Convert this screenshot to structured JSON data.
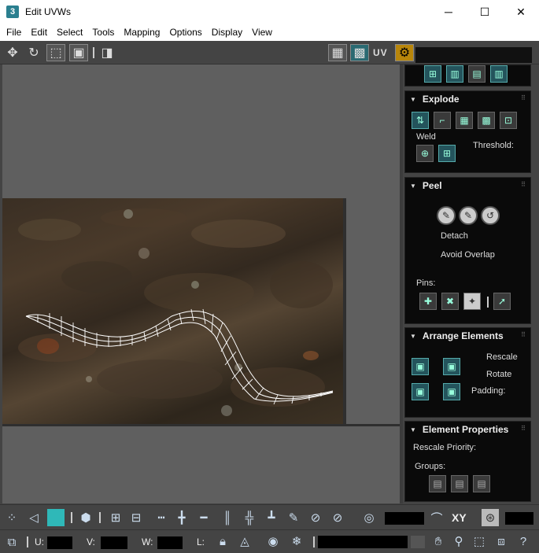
{
  "window": {
    "app_icon": "3",
    "title": "Edit UVWs",
    "minimize_glyph": "─",
    "maximize_glyph": "☐",
    "close_glyph": "✕"
  },
  "menu": [
    "File",
    "Edit",
    "Select",
    "Tools",
    "Mapping",
    "Options",
    "Display",
    "View"
  ],
  "toolbar_top": {
    "uv_label": "UV",
    "icons": [
      "move-icon",
      "rotate-icon",
      "scale-icon",
      "freeform-icon",
      "mirror-icon",
      "checker-icon",
      "texture-icon",
      "uv-settings-icon"
    ]
  },
  "panels": {
    "explode": {
      "title": "Explode",
      "weld_label": "Weld",
      "threshold_label": "Threshold:"
    },
    "peel": {
      "title": "Peel",
      "detach_label": "Detach",
      "avoid_overlap_label": "Avoid Overlap",
      "pins_label": "Pins:"
    },
    "arrange": {
      "title": "Arrange Elements",
      "rescale_label": "Rescale",
      "rotate_label": "Rotate",
      "padding_label": "Padding:"
    },
    "element_props": {
      "title": "Element Properties",
      "rescale_priority_label": "Rescale Priority:",
      "groups_label": "Groups:"
    }
  },
  "bottom": {
    "xy_label": "XY",
    "u_label": "U:",
    "v_label": "V:",
    "w_label": "W:",
    "l_label": "L:"
  },
  "colors": {
    "accent": "#2a7f8f",
    "panel_bg": "#0a0a0a",
    "ui_bg": "#444444",
    "wire": "#ffffff"
  }
}
